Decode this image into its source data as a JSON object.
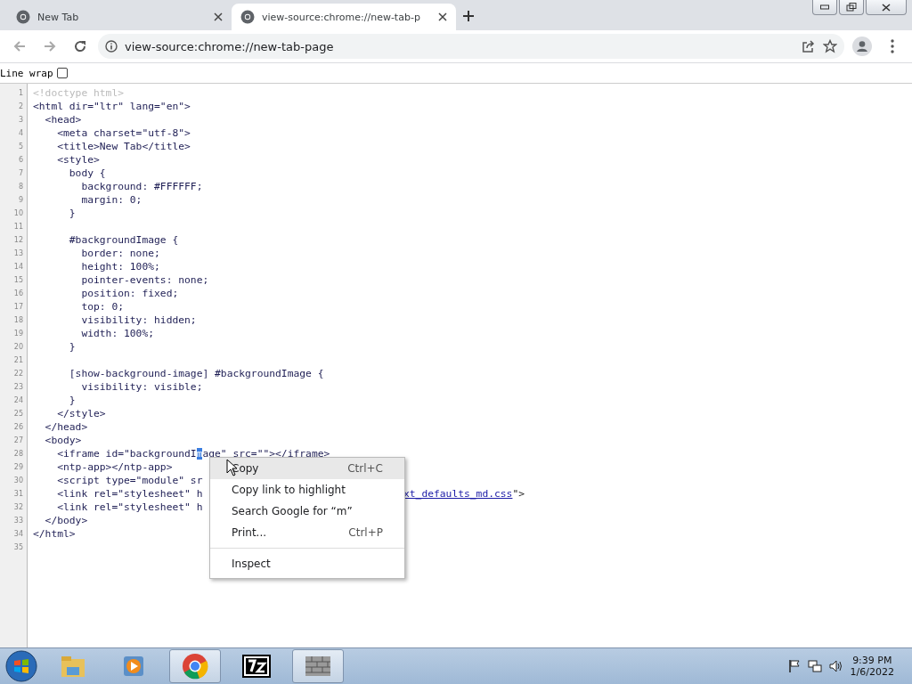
{
  "tabs": [
    {
      "title": "New Tab",
      "selected": false
    },
    {
      "title": "view-source:chrome://new-tab-p",
      "selected": true
    }
  ],
  "address_bar": {
    "value": "view-source:chrome://new-tab-page"
  },
  "line_wrap": {
    "label": "Line wrap",
    "checked": false
  },
  "code_lines": [
    {
      "number": "1",
      "kind": "doctype",
      "text": "<!doctype html>"
    },
    {
      "number": "2",
      "kind": "code",
      "text": "<html dir=\"ltr\" lang=\"en\">"
    },
    {
      "number": "3",
      "kind": "code",
      "text": "  <head>"
    },
    {
      "number": "4",
      "kind": "code",
      "text": "    <meta charset=\"utf-8\">"
    },
    {
      "number": "5",
      "kind": "code",
      "text": "    <title>New Tab</title>"
    },
    {
      "number": "6",
      "kind": "code",
      "text": "    <style>"
    },
    {
      "number": "7",
      "kind": "code",
      "text": "      body {"
    },
    {
      "number": "8",
      "kind": "code",
      "text": "        background: #FFFFFF;"
    },
    {
      "number": "9",
      "kind": "code",
      "text": "        margin: 0;"
    },
    {
      "number": "10",
      "kind": "code",
      "text": "      }"
    },
    {
      "number": "11"
    },
    {
      "number": "12",
      "kind": "code",
      "text": "      #backgroundImage {"
    },
    {
      "number": "13",
      "kind": "code",
      "text": "        border: none;"
    },
    {
      "number": "14",
      "kind": "code",
      "text": "        height: 100%;"
    },
    {
      "number": "15",
      "kind": "code",
      "text": "        pointer-events: none;"
    },
    {
      "number": "16",
      "kind": "code",
      "text": "        position: fixed;"
    },
    {
      "number": "17",
      "kind": "code",
      "text": "        top: 0;"
    },
    {
      "number": "18",
      "kind": "code",
      "text": "        visibility: hidden;"
    },
    {
      "number": "19",
      "kind": "code",
      "text": "        width: 100%;"
    },
    {
      "number": "20",
      "kind": "code",
      "text": "      }"
    },
    {
      "number": "21"
    },
    {
      "number": "22",
      "kind": "code",
      "text": "      [show-background-image] #backgroundImage {"
    },
    {
      "number": "23",
      "kind": "code",
      "text": "        visibility: visible;"
    },
    {
      "number": "24",
      "kind": "code",
      "text": "      }"
    },
    {
      "number": "25",
      "kind": "code",
      "text": "    </style>"
    },
    {
      "number": "26",
      "kind": "code",
      "text": "  </head>"
    },
    {
      "number": "27",
      "kind": "code",
      "text": "  <body>"
    },
    {
      "number": "28",
      "kind": "code",
      "text": "    <iframe id=\"backgroundI",
      "selected_text": "m",
      "after_text": "age\" src=\"\"></iframe>"
    },
    {
      "number": "29",
      "kind": "code",
      "text": "    <ntp-app></ntp-app>"
    },
    {
      "number": "30",
      "kind": "code",
      "text": "    <script type=\"module\" sr"
    },
    {
      "number": "31",
      "kind": "code",
      "text": "    <link rel=\"stylesheet\" h",
      "link_tail": "xt_defaults_md.css",
      "tail_end": "\">"
    },
    {
      "number": "32",
      "kind": "code",
      "text": "    <link rel=\"stylesheet\" h"
    },
    {
      "number": "33",
      "kind": "code",
      "text": "  </body>"
    },
    {
      "number": "34",
      "kind": "code",
      "text": "</html>"
    },
    {
      "number": "35"
    }
  ],
  "context_menu": [
    {
      "label": "Copy",
      "shortcut": "Ctrl+C",
      "selected": true
    },
    {
      "label": "Copy link to highlight",
      "selected": false
    },
    {
      "label": "Search Google for “m”",
      "selected": false
    },
    {
      "label": "Print...",
      "shortcut": "Ctrl+P",
      "selected": false,
      "separator_after": true
    },
    {
      "label": "Inspect",
      "selected": false
    }
  ],
  "clock": {
    "time": "9:39 PM",
    "date": "1/6/2022"
  }
}
